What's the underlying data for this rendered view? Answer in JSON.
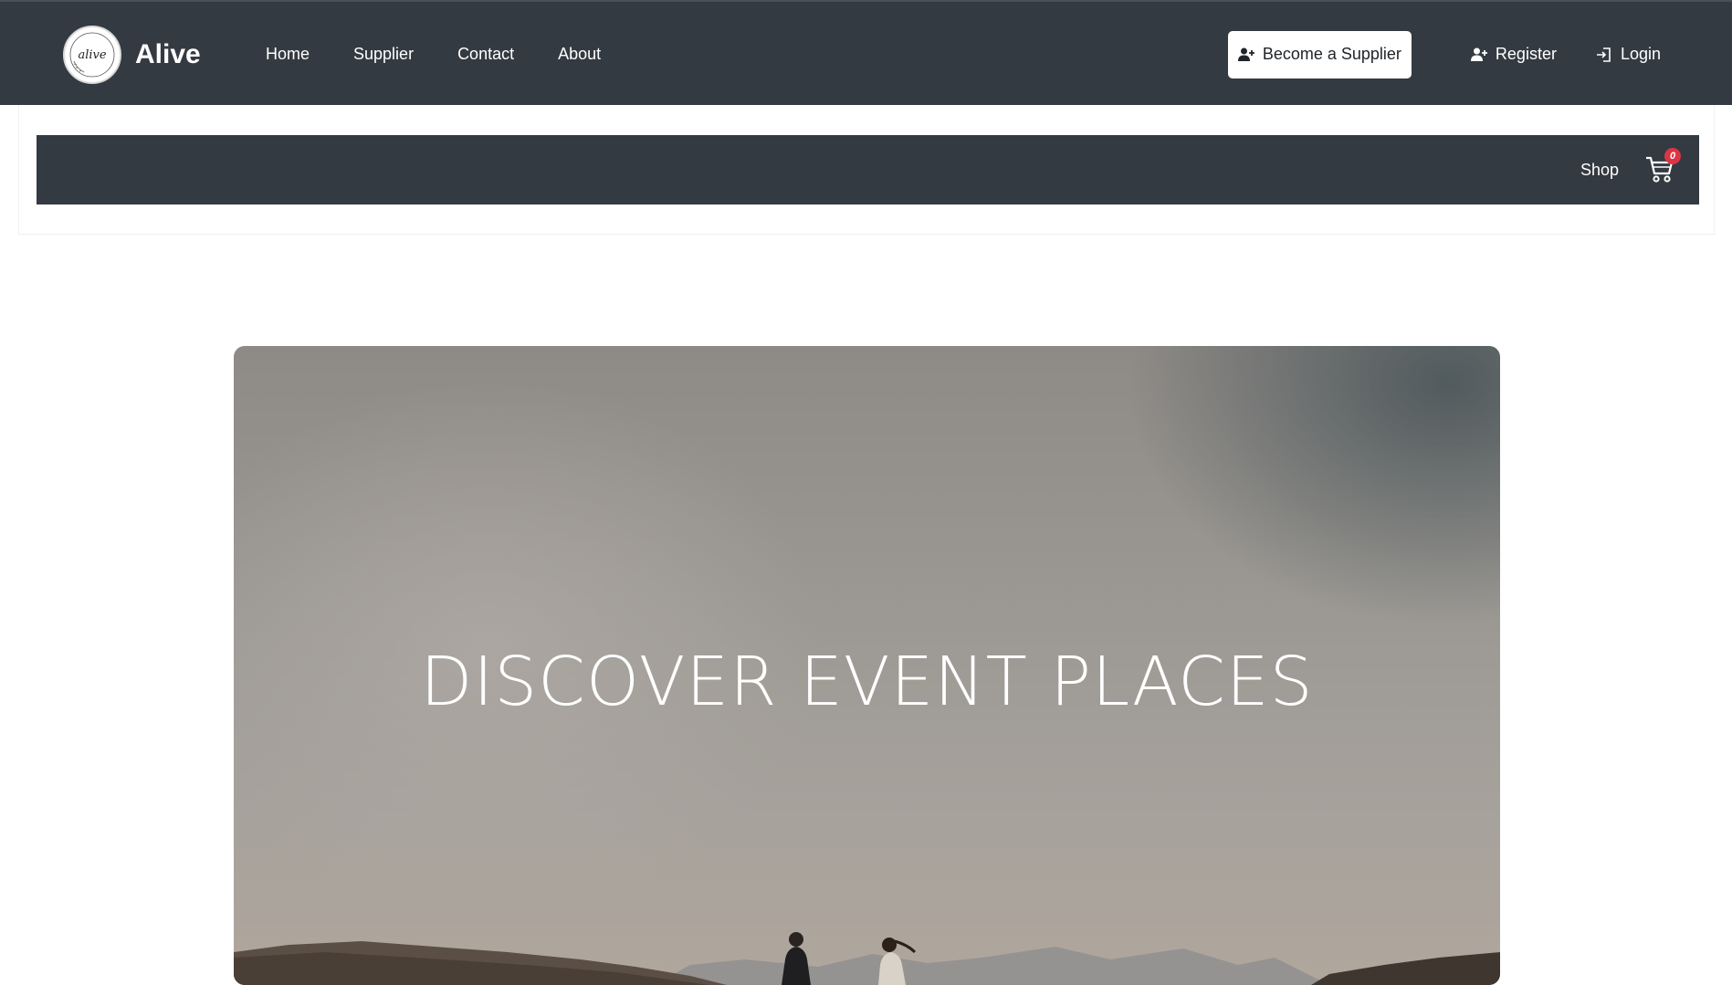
{
  "header": {
    "brand_name": "Alive",
    "logo_text": "alive",
    "nav_links": [
      {
        "label": "Home"
      },
      {
        "label": "Supplier"
      },
      {
        "label": "Contact"
      },
      {
        "label": "About"
      }
    ],
    "become_supplier_label": "Become a Supplier",
    "register_label": "Register",
    "login_label": "Login"
  },
  "shopbar": {
    "shop_label": "Shop",
    "cart_count": "0"
  },
  "hero": {
    "title": "DISCOVER EVENT PLACES"
  },
  "colors": {
    "nav_bg": "#343a41",
    "badge": "#dc3545"
  }
}
